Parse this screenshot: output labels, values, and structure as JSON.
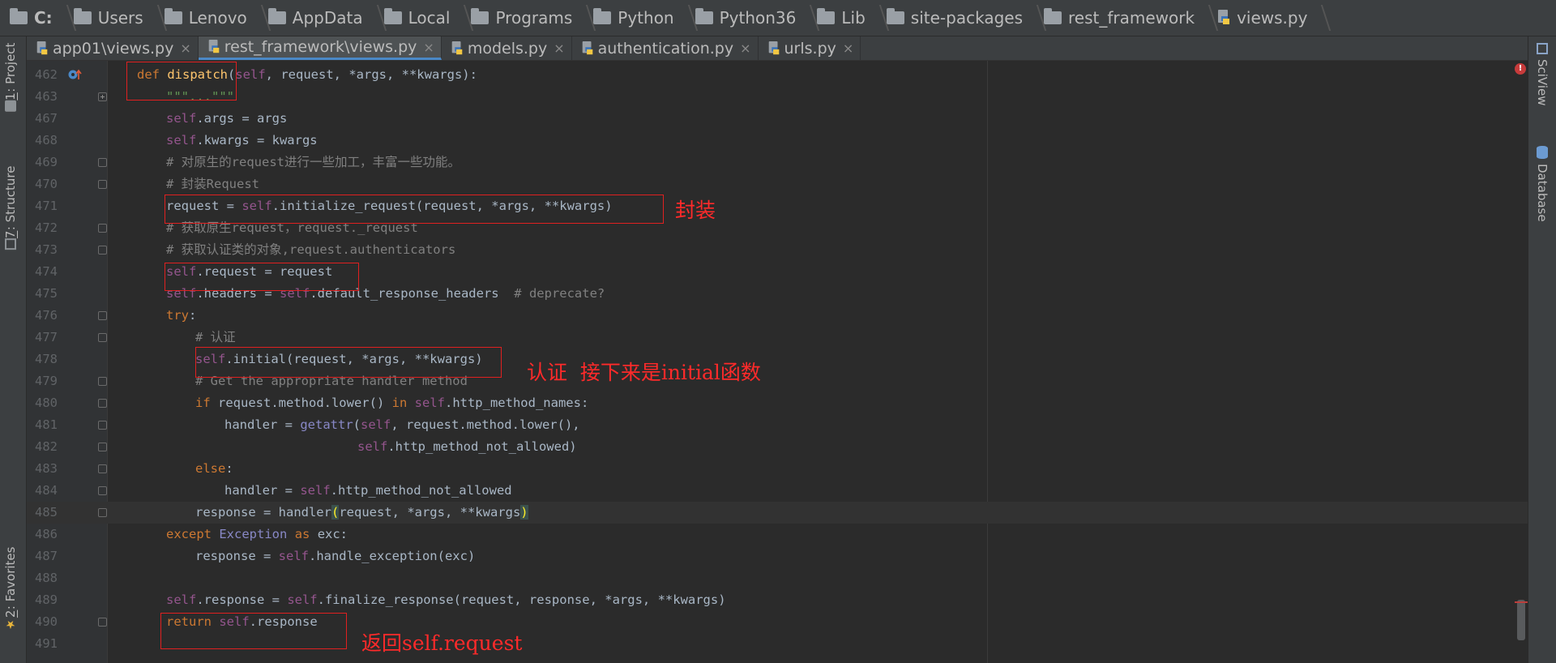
{
  "breadcrumb": [
    {
      "label": "C:",
      "icon": "folder-icon"
    },
    {
      "label": "Users",
      "icon": "folder-icon"
    },
    {
      "label": "Lenovo",
      "icon": "folder-icon"
    },
    {
      "label": "AppData",
      "icon": "folder-icon"
    },
    {
      "label": "Local",
      "icon": "folder-icon"
    },
    {
      "label": "Programs",
      "icon": "folder-icon"
    },
    {
      "label": "Python",
      "icon": "folder-icon"
    },
    {
      "label": "Python36",
      "icon": "folder-icon"
    },
    {
      "label": "Lib",
      "icon": "folder-icon"
    },
    {
      "label": "site-packages",
      "icon": "folder-icon"
    },
    {
      "label": "rest_framework",
      "icon": "folder-icon"
    },
    {
      "label": "views.py",
      "icon": "python-file-icon"
    }
  ],
  "tabs": [
    {
      "label": "app01\\views.py",
      "close": "×",
      "active": false
    },
    {
      "label": "rest_framework\\views.py",
      "close": "×",
      "active": true
    },
    {
      "label": "models.py",
      "close": "×",
      "active": false
    },
    {
      "label": "authentication.py",
      "close": "×",
      "active": false
    },
    {
      "label": "urls.py",
      "close": "×",
      "active": false
    }
  ],
  "left_tool_windows": {
    "project": {
      "num": "1",
      "label": ": Project"
    },
    "structure": {
      "num": "7",
      "label": ": Structure"
    },
    "favorites": {
      "num": "2",
      "label": ": Favorites"
    }
  },
  "right_tool_windows": {
    "sciview": "SciView",
    "database": "Database"
  },
  "editor": {
    "error_badge": "!",
    "line_numbers": [
      "462",
      "463",
      "467",
      "468",
      "469",
      "470",
      "471",
      "472",
      "473",
      "474",
      "475",
      "476",
      "477",
      "478",
      "479",
      "480",
      "481",
      "482",
      "483",
      "484",
      "485",
      "486",
      "487",
      "488",
      "489",
      "490",
      "491"
    ],
    "lines": {
      "l462_kw": "def",
      "l462_fn": "dispatch",
      "l462_self": "self",
      "l462_rest": ", request, *args, **kwargs):",
      "l463": "\"\"\"...\"\"\"",
      "l467_self": "self",
      "l467_rest": ".args = args",
      "l468_self": "self",
      "l468_rest": ".kwargs = kwargs",
      "l469": "# 对原生的request进行一些加工，丰富一些功能。",
      "l470": "# 封装Request",
      "l471_a": "request = ",
      "l471_self": "self",
      "l471_b": ".initialize_request(request, *args, **kwargs)",
      "l472": "# 获取原生request，request._request",
      "l473": "# 获取认证类的对象,request.authenticators",
      "l474_self": "self",
      "l474_rest": ".request = request",
      "l475_self": "self",
      "l475_a": ".headers = ",
      "l475_self2": "self",
      "l475_b": ".default_response_headers  ",
      "l475_cm": "# deprecate?",
      "l476_kw": "try",
      "l476_rest": ":",
      "l477": "# 认证",
      "l478_self": "self",
      "l478_rest": ".initial(request, *args, **kwargs)",
      "l479": "# Get the appropriate handler method",
      "l480_kw": "if",
      "l480_a": " request.method.lower() ",
      "l480_kw2": "in",
      "l480_sp": " ",
      "l480_self": "self",
      "l480_b": ".http_method_names:",
      "l481_a": "handler = ",
      "l481_bi": "getattr",
      "l481_p": "(",
      "l481_self": "self",
      "l481_b": ", request.method.lower(),",
      "l482_self": "self",
      "l482_rest": ".http_method_not_allowed)",
      "l483_kw": "else",
      "l483_rest": ":",
      "l484_a": "handler = ",
      "l484_self": "self",
      "l484_b": ".http_method_not_allowed",
      "l485_a": "response = handler",
      "l485_br1": "(",
      "l485_b": "request, *args, **kwargs",
      "l485_br2": ")",
      "l486_kw": "except",
      "l486_sp": " ",
      "l486_bi": "Exception",
      "l486_sp2": " ",
      "l486_kw2": "as",
      "l486_rest": " exc:",
      "l487_a": "response = ",
      "l487_self": "self",
      "l487_b": ".handle_exception(exc)",
      "l489_self": "self",
      "l489_a": ".response = ",
      "l489_self2": "self",
      "l489_b": ".finalize_response(request, response, *args, **kwargs)",
      "l490_kw": "return",
      "l490_sp": " ",
      "l490_self": "self",
      "l490_rest": ".response"
    }
  },
  "annotations": {
    "wrap": "封装",
    "auth": "认证  接下来是initial函数",
    "ret": "返回self.request"
  },
  "colors": {
    "annotation": "#e02020",
    "keyword": "#cc7832",
    "self": "#94558d",
    "function": "#ffc66d",
    "comment": "#808080"
  }
}
